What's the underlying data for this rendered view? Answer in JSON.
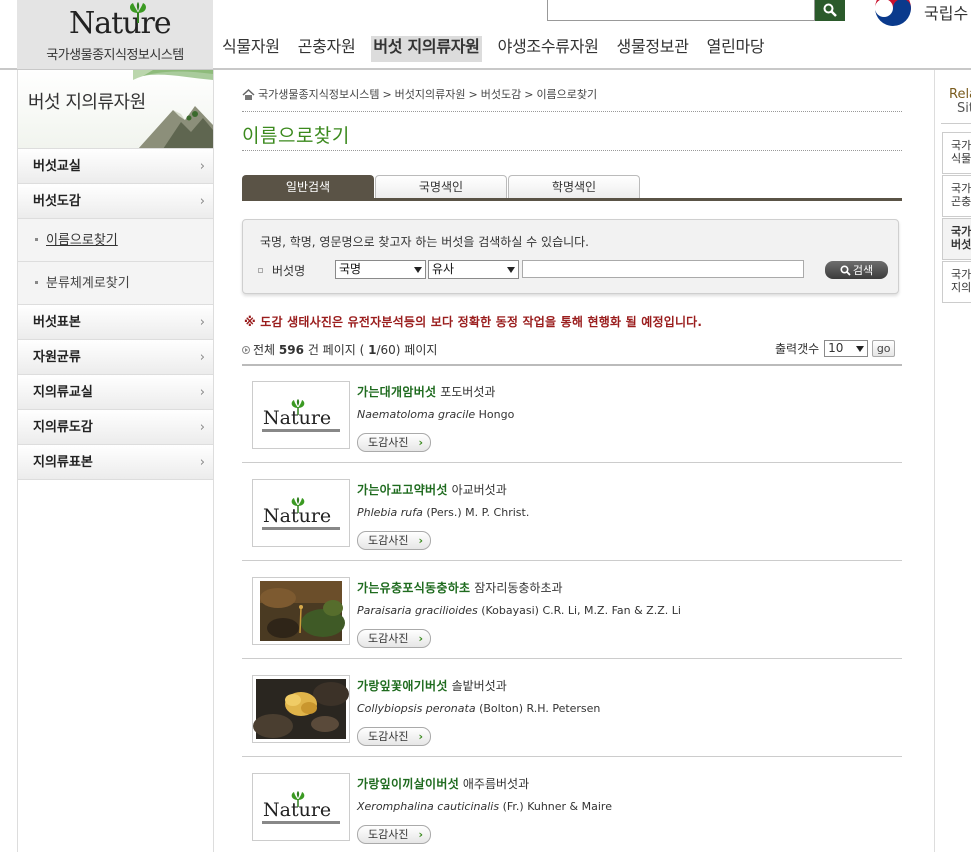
{
  "header": {
    "logo_text": "Nature",
    "logo_subtitle": "국가생물종지식정보시스템",
    "agency_name": "국립수",
    "nav": [
      "식물자원",
      "곤충자원",
      "버섯 지의류자원",
      "야생조수류자원",
      "생물정보관",
      "열린마당"
    ],
    "nav_active": 2
  },
  "sidebar": {
    "title": "버섯 지의류자원",
    "items": [
      {
        "label": "버섯교실"
      },
      {
        "label": "버섯도감"
      },
      {
        "label": "이름으로찾기",
        "sub": true,
        "active": true
      },
      {
        "label": "분류체계로찾기",
        "sub": true
      },
      {
        "label": "버섯표본"
      },
      {
        "label": "자원균류"
      },
      {
        "label": "지의류교실"
      },
      {
        "label": "지의류도감"
      },
      {
        "label": "지의류표본"
      }
    ]
  },
  "related": {
    "title_1": "Rela",
    "title_2": "Sit",
    "items": [
      "국가\n식물",
      "국가\n곤충",
      "국가\n버섯",
      "국가\n지의류"
    ]
  },
  "breadcrumb": [
    "국가생물종지식정보시스템",
    "버섯지의류자원",
    "버섯도감",
    "이름으로찾기"
  ],
  "breadcrumb_sep": ">",
  "page_title": "이름으로찾기",
  "tabs": [
    "일반검색",
    "국명색인",
    "학명색인"
  ],
  "search": {
    "description": "국명, 학명, 영문명으로 찾고자 하는 버섯을 검색하실 수 있습니다.",
    "label": "버섯명",
    "field_value": "국명",
    "match_value": "유사",
    "button_label": "검색"
  },
  "notice": "※ 도감 생태사진은 유전자분석등의 보다 정확한 동정 작업을 통해 현행화 될 예정입니다.",
  "results": {
    "prefix": "전체",
    "total": "596",
    "unit": "건 페이지 (",
    "current": "1",
    "pages": "/60) 페이지",
    "per_page_label": "출력갯수",
    "per_page_value": "10",
    "go_label": "go"
  },
  "list": [
    {
      "name": "가는대개암버섯",
      "family": "포도버섯과",
      "sci": "Naematoloma gracile",
      "author": "Hongo",
      "photo": "logo",
      "btn": "도감사진"
    },
    {
      "name": "가는아교고약버섯",
      "family": "아교버섯과",
      "sci": "Phlebia rufa",
      "author": "(Pers.) M. P. Christ.",
      "photo": "logo",
      "btn": "도감사진"
    },
    {
      "name": "가는유충포식동충하초",
      "family": "잠자리동충하초과",
      "sci": "Paraisaria gracilioides",
      "author": "(Kobayasi) C.R. Li, M.Z. Fan & Z.Z. Li",
      "photo": "moss",
      "btn": "도감사진"
    },
    {
      "name": "가랑잎꽃애기버섯",
      "family": "솔밭버섯과",
      "sci": "Collybiopsis peronata",
      "author": "(Bolton) R.H. Petersen",
      "photo": "yellow",
      "btn": "도감사진"
    },
    {
      "name": "가랑잎이끼살이버섯",
      "family": "애주름버섯과",
      "sci": "Xeromphalina cauticinalis",
      "author": "(Fr.) Kuhner & Maire",
      "photo": "logo",
      "btn": "도감사진"
    }
  ],
  "colors": {
    "accent_green": "#3c8a1e",
    "name_green": "#1f6b1f",
    "tab_active": "#5a5346",
    "notice_red": "#9a1d1d"
  }
}
